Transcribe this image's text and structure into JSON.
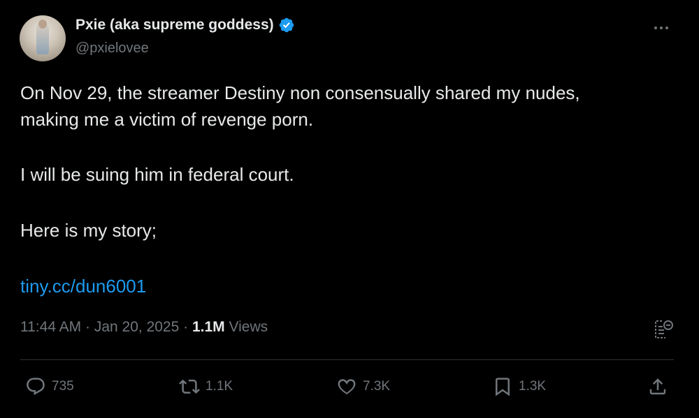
{
  "author": {
    "display_name": "Pxie (aka supreme goddess)",
    "handle": "@pxielovee",
    "verified": true,
    "verified_color": "#1d9bf0"
  },
  "tweet": {
    "line1": "On Nov 29, the streamer Destiny non consensually shared my nudes,",
    "line2": "making me a victim of revenge porn.",
    "paragraph2": "I will be suing him in federal court.",
    "paragraph3": "Here is my story;",
    "link": "tiny.cc/dun6001",
    "link_color": "#1d9bf0"
  },
  "meta": {
    "time": "11:44 AM",
    "separator1": " · ",
    "date": "Jan 20, 2025",
    "separator2": " · ",
    "views_count": "1.1M",
    "views_label": " Views"
  },
  "actions": {
    "replies": "735",
    "retweets": "1.1K",
    "likes": "7.3K",
    "bookmarks": "1.3K"
  },
  "icons": [
    "more-icon",
    "verified-icon",
    "analytics-icon",
    "reply-icon",
    "retweet-icon",
    "like-icon",
    "bookmark-icon",
    "share-icon"
  ],
  "colors": {
    "background": "#000000",
    "text": "#e7e9ea",
    "muted": "#71767b",
    "divider": "#2f3336"
  }
}
